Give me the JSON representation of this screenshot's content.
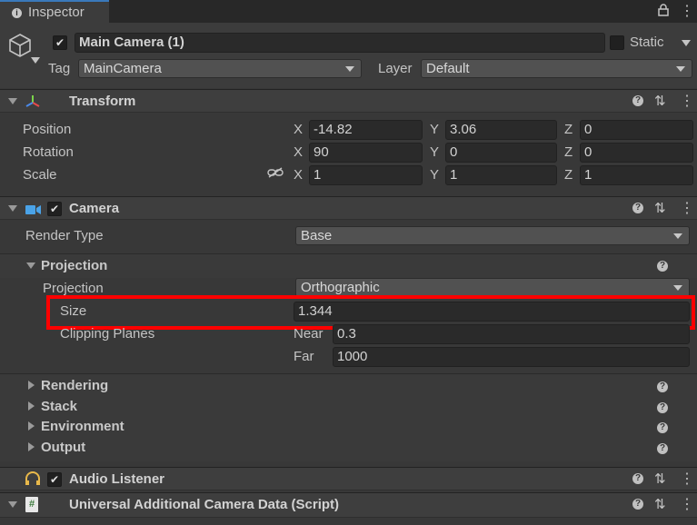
{
  "tab": {
    "title": "Inspector"
  },
  "gameobject": {
    "name": "Main Camera (1)",
    "static_label": "Static",
    "tag_label": "Tag",
    "tag_value": "MainCamera",
    "layer_label": "Layer",
    "layer_value": "Default"
  },
  "transform": {
    "title": "Transform",
    "position": {
      "label": "Position",
      "x": "-14.82",
      "y": "3.06",
      "z": "0"
    },
    "rotation": {
      "label": "Rotation",
      "x": "90",
      "y": "0",
      "z": "0"
    },
    "scale": {
      "label": "Scale",
      "x": "1",
      "y": "1",
      "z": "1"
    },
    "axis_x": "X",
    "axis_y": "Y",
    "axis_z": "Z"
  },
  "camera": {
    "title": "Camera",
    "render_type_label": "Render Type",
    "render_type_value": "Base",
    "projection_section": "Projection",
    "projection_label": "Projection",
    "projection_value": "Orthographic",
    "size_label": "Size",
    "size_value": "1.344",
    "clipping_label": "Clipping Planes",
    "near_label": "Near",
    "near_value": "0.3",
    "far_label": "Far",
    "far_value": "1000",
    "sections": [
      "Rendering",
      "Stack",
      "Environment",
      "Output"
    ]
  },
  "audio_listener": {
    "title": "Audio Listener"
  },
  "script": {
    "title": "Universal Additional Camera Data (Script)",
    "icon": "#"
  },
  "colors": {
    "highlight": "#ff0000",
    "tab_accent": "#3a79bb"
  }
}
